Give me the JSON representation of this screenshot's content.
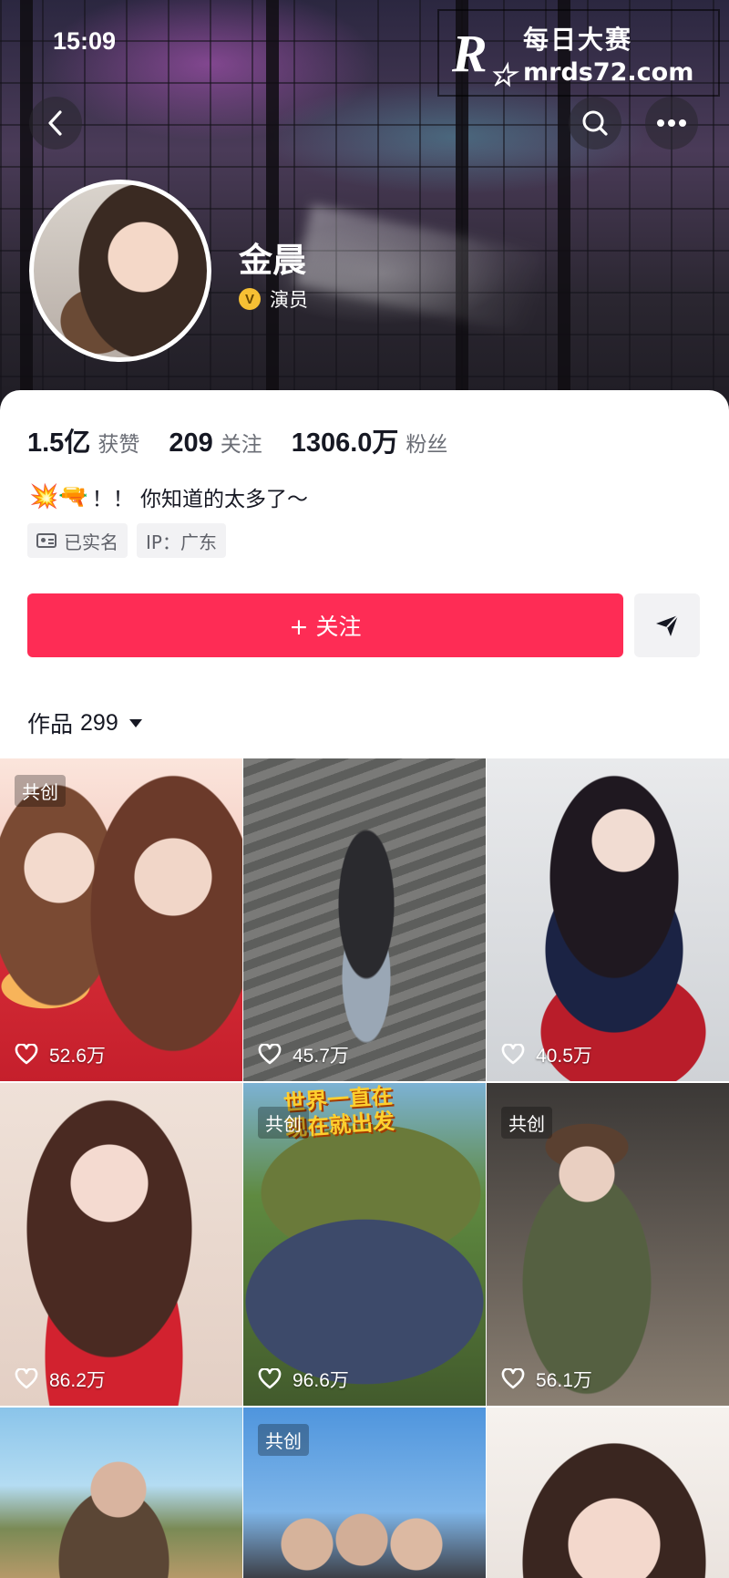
{
  "status_bar": {
    "time": "15:09"
  },
  "watermark": {
    "logo_letter": "R",
    "name": "每日大赛",
    "url": "mrds72.com"
  },
  "profile": {
    "name": "金晨",
    "verified_label": "演员",
    "verified_icon": "v-badge-icon",
    "stats": [
      {
        "value": "1.5亿",
        "label": "获赞"
      },
      {
        "value": "209",
        "label": "关注"
      },
      {
        "value": "1306.0万",
        "label": "粉丝"
      }
    ],
    "bio_emoji": "💥🔫",
    "bio_text": "！！ 你知道的太多了～",
    "tags": [
      {
        "icon": "id-card-icon",
        "label": "已实名"
      },
      {
        "label": "IP：广东"
      }
    ],
    "follow_label": "+ 关注",
    "share_icon": "send-icon"
  },
  "works": {
    "label": "作品",
    "count": "299",
    "items": [
      {
        "badge": "共创",
        "likes": "52.6万"
      },
      {
        "badge": "",
        "likes": "45.7万"
      },
      {
        "badge": "",
        "likes": "40.5万"
      },
      {
        "badge": "",
        "likes": "86.2万"
      },
      {
        "badge": "共创",
        "likes": "96.6万",
        "title": "世界一直在 现在就出发"
      },
      {
        "badge": "共创",
        "likes": "56.1万"
      },
      {
        "badge": "",
        "likes": ""
      },
      {
        "badge": "共创",
        "likes": ""
      },
      {
        "badge": "",
        "likes": ""
      }
    ]
  },
  "colors": {
    "accent": "#fe2c55",
    "text": "#161823",
    "muted": "#6b6e76",
    "badge_gold": "#f6c034"
  }
}
